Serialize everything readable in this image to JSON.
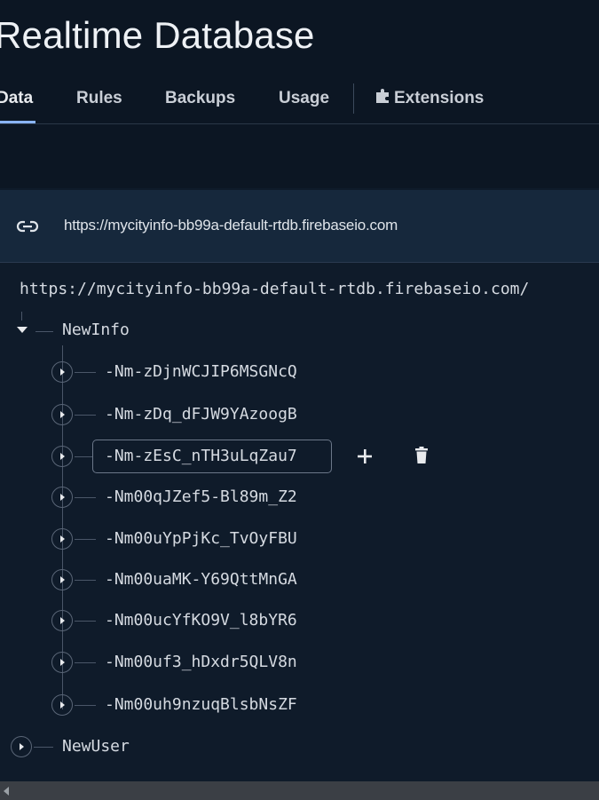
{
  "page": {
    "title": "Realtime Database"
  },
  "tabs": [
    {
      "label": "Data",
      "active": true
    },
    {
      "label": "Rules",
      "active": false
    },
    {
      "label": "Backups",
      "active": false
    },
    {
      "label": "Usage",
      "active": false
    },
    {
      "label": "Extensions",
      "active": false,
      "icon": "extensions-icon"
    }
  ],
  "url_bar": {
    "icon": "link-icon",
    "url": "https://mycityinfo-bb99a-default-rtdb.firebaseio.com"
  },
  "tree": {
    "root_url": "https://mycityinfo-bb99a-default-rtdb.firebaseio.com/",
    "nodes": [
      {
        "key": "NewInfo",
        "expanded": true,
        "children": [
          {
            "key": "-Nm-zDjnWCJIP6MSGNcQ"
          },
          {
            "key": "-Nm-zDq_dFJW9YAzoogB"
          },
          {
            "key": "-Nm-zEsC_nTH3uLqZau7",
            "hovered": true
          },
          {
            "key": "-Nm00qJZef5-Bl89m_Z2"
          },
          {
            "key": "-Nm00uYpPjKc_TvOyFBU"
          },
          {
            "key": "-Nm00uaMK-Y69QttMnGA"
          },
          {
            "key": "-Nm00ucYfKO9V_l8bYR6"
          },
          {
            "key": "-Nm00uf3_hDxdr5QLV8n"
          },
          {
            "key": "-Nm00uh9nzuqBlsbNsZF"
          }
        ]
      },
      {
        "key": "NewUser",
        "expanded": false
      }
    ],
    "hover_actions": {
      "add_icon": "plus-icon",
      "delete_icon": "trash-icon"
    }
  },
  "colors": {
    "background": "#0f1b2a",
    "header": "#0c1623",
    "url_bar": "#16283c",
    "accent": "#8ab4f8"
  }
}
